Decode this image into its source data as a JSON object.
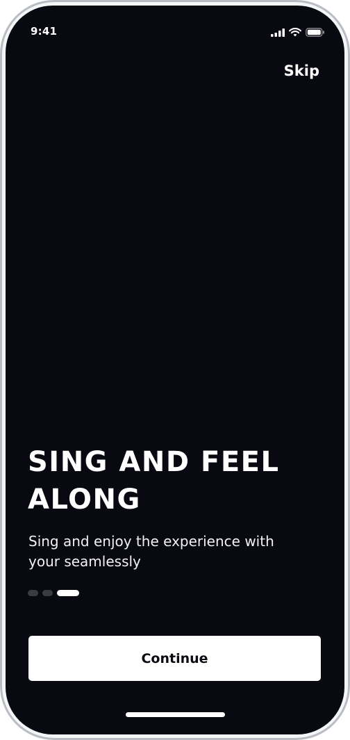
{
  "status_bar": {
    "time": "9:41",
    "icons": [
      "cellular-signal-icon",
      "wifi-icon",
      "battery-icon"
    ]
  },
  "header": {
    "skip_label": "Skip"
  },
  "onboarding": {
    "title": "SING AND FEEL ALONG",
    "subtitle": "Sing and enjoy the experience with your seamlessly",
    "page_indicator": {
      "total": 3,
      "current": 3
    },
    "continue_label": "Continue"
  },
  "colors": {
    "background": "#080911",
    "text": "#ffffff",
    "button_background": "#ffffff",
    "button_text": "#0a0b12",
    "inactive_dot": "#3a3c44"
  }
}
